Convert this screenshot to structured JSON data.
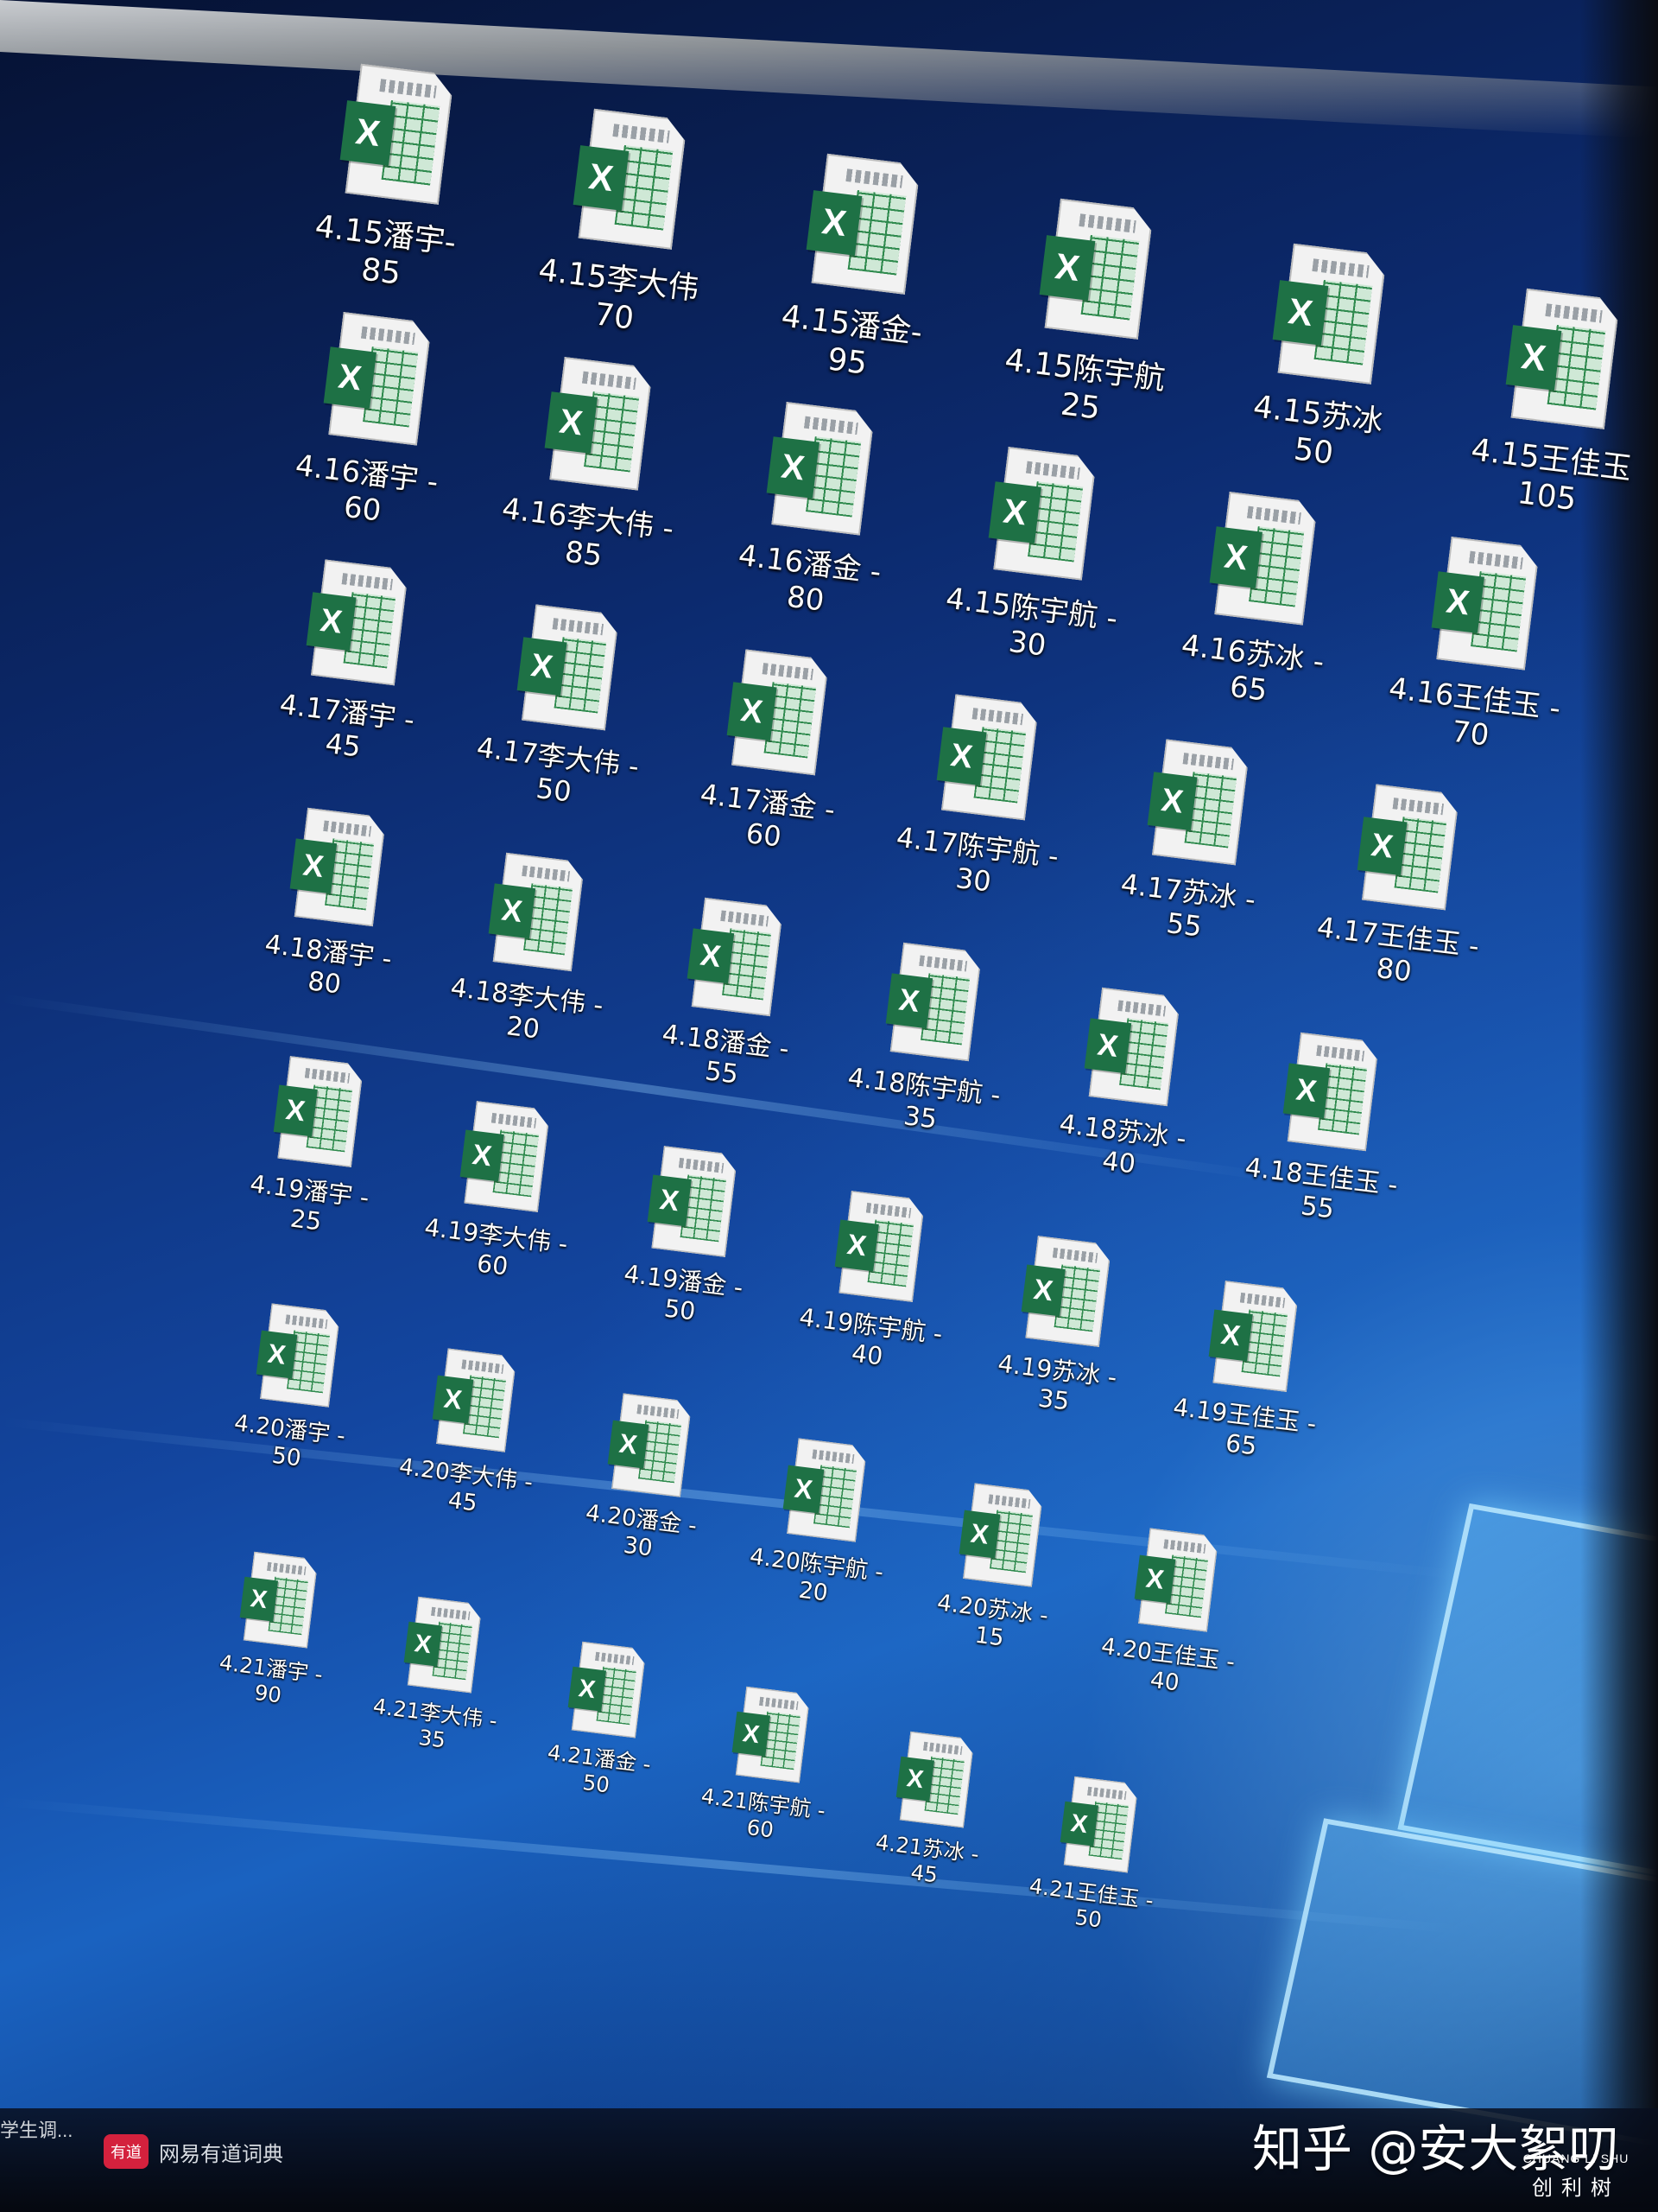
{
  "desktop": {
    "icons": [
      {
        "label": "4.15潘宇-\n85",
        "badge": "X"
      },
      {
        "label": "4.15李大伟\n70",
        "badge": "X"
      },
      {
        "label": "4.15潘金-\n95",
        "badge": "X"
      },
      {
        "label": "4.15陈宇航\n25",
        "badge": "X"
      },
      {
        "label": "4.15苏冰\n50",
        "badge": "X"
      },
      {
        "label": "4.15王佳玉\n105",
        "badge": "X"
      },
      {
        "label": "4.16潘宇 -\n60",
        "badge": "X"
      },
      {
        "label": "4.16李大伟 -\n85",
        "badge": "X"
      },
      {
        "label": "4.16潘金 -\n80",
        "badge": "X"
      },
      {
        "label": "4.15陈宇航 -\n30",
        "badge": "X"
      },
      {
        "label": "4.16苏冰 -\n65",
        "badge": "X"
      },
      {
        "label": "4.16王佳玉 -\n70",
        "badge": "X"
      },
      {
        "label": "4.17潘宇 -\n45",
        "badge": "X"
      },
      {
        "label": "4.17李大伟 -\n50",
        "badge": "X"
      },
      {
        "label": "4.17潘金 -\n60",
        "badge": "X"
      },
      {
        "label": "4.17陈宇航 -\n30",
        "badge": "X"
      },
      {
        "label": "4.17苏冰 -\n55",
        "badge": "X"
      },
      {
        "label": "4.17王佳玉 -\n80",
        "badge": "X"
      },
      {
        "label": "4.18潘宇 -\n80",
        "badge": "X"
      },
      {
        "label": "4.18李大伟 -\n20",
        "badge": "X"
      },
      {
        "label": "4.18潘金 -\n55",
        "badge": "X"
      },
      {
        "label": "4.18陈宇航 -\n35",
        "badge": "X"
      },
      {
        "label": "4.18苏冰 -\n40",
        "badge": "X"
      },
      {
        "label": "4.18王佳玉 -\n55",
        "badge": "X"
      },
      {
        "label": "4.19潘宇 -\n25",
        "badge": "X"
      },
      {
        "label": "4.19李大伟 -\n60",
        "badge": "X"
      },
      {
        "label": "4.19潘金 -\n50",
        "badge": "X"
      },
      {
        "label": "4.19陈宇航 -\n40",
        "badge": "X"
      },
      {
        "label": "4.19苏冰 -\n35",
        "badge": "X"
      },
      {
        "label": "4.19王佳玉 -\n65",
        "badge": "X"
      },
      {
        "label": "4.20潘宇 -\n50",
        "badge": "X"
      },
      {
        "label": "4.20李大伟 -\n45",
        "badge": "X"
      },
      {
        "label": "4.20潘金 -\n30",
        "badge": "X"
      },
      {
        "label": "4.20陈宇航 -\n20",
        "badge": "X"
      },
      {
        "label": "4.20苏冰 -\n15",
        "badge": "X"
      },
      {
        "label": "4.20王佳玉 -\n40",
        "badge": "X"
      },
      {
        "label": "4.21潘宇 -\n90",
        "badge": "X"
      },
      {
        "label": "4.21李大伟 -\n35",
        "badge": "X"
      },
      {
        "label": "4.21潘金 -\n50",
        "badge": "X"
      },
      {
        "label": "4.21陈宇航 -\n60",
        "badge": "X"
      },
      {
        "label": "4.21苏冰 -\n45",
        "badge": "X"
      },
      {
        "label": "4.21王佳玉 -\n50",
        "badge": "X"
      }
    ]
  },
  "taskbar": {
    "left_text": "学生调...",
    "app_logo": "有道",
    "app_label": "网易有道词典"
  },
  "watermark": {
    "text": "知乎 @安大絮叨",
    "brand_en": "CHUANG LI SHU",
    "brand_cn": "创利树"
  },
  "icon_names": {
    "file": "excel-file-icon",
    "taskbar_app": "youdao-dictionary-icon"
  }
}
